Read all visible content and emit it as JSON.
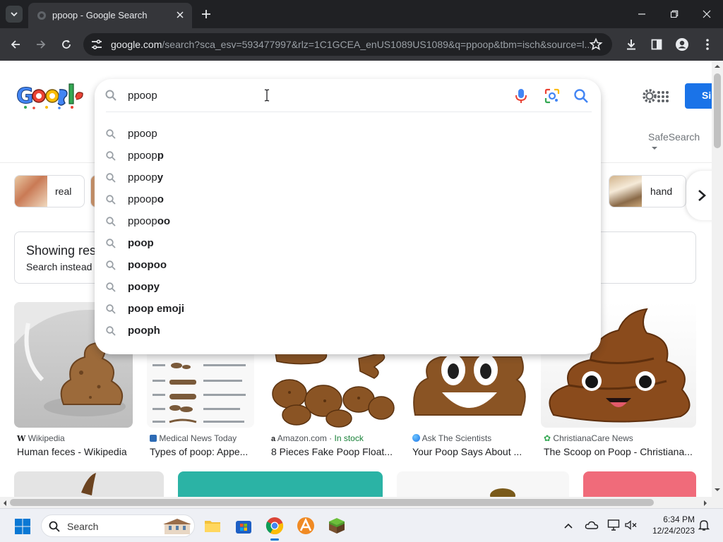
{
  "browser": {
    "tab_title": "ppoop - Google Search",
    "url_domain": "google.com",
    "url_path": "/search?sca_esv=593477997&rlz=1C1GCEA_enUS1089US1089&q=ppoop&tbm=isch&source=l..."
  },
  "search": {
    "query": "ppoop",
    "suggestions": [
      {
        "plain": "ppoop",
        "bold": ""
      },
      {
        "plain": "ppoop",
        "bold": "p"
      },
      {
        "plain": "ppoop",
        "bold": "y"
      },
      {
        "plain": "ppoop",
        "bold": "o"
      },
      {
        "plain": "ppoop",
        "bold": "oo"
      },
      {
        "plain": "",
        "bold": "poop"
      },
      {
        "plain": "",
        "bold": "poopoo"
      },
      {
        "plain": "",
        "bold": "poopy"
      },
      {
        "plain": "",
        "bold": "poop emoji"
      },
      {
        "plain": "",
        "bold": "pooph"
      }
    ]
  },
  "header": {
    "signin_label": "Si",
    "safesearch_label": "SafeSearch"
  },
  "chips": {
    "left_label": "real",
    "right_label": "hand"
  },
  "notice": {
    "line1": "Showing res",
    "line2": "Search instead"
  },
  "results": [
    {
      "source": "Wikipedia",
      "title": "Human feces - Wikipedia",
      "stock": ""
    },
    {
      "source": "Medical News Today",
      "title": "Types of poop: Appe...",
      "stock": ""
    },
    {
      "source": "Amazon.com",
      "title": "8 Pieces Fake Poop Float...",
      "stock": "In stock"
    },
    {
      "source": "Ask The Scientists",
      "title": "Your Poop Says About ...",
      "stock": ""
    },
    {
      "source": "ChristianaCare News",
      "title": "The Scoop on Poop - Christiana...",
      "stock": ""
    }
  ],
  "taskbar": {
    "search_label": "Search",
    "time": "6:34 PM",
    "date": "12/24/2023"
  },
  "colors": {
    "accent_blue": "#1a73e8",
    "stock_green": "#188038",
    "poop_brown": "#8a5424",
    "teal_card": "#2bb3a5",
    "pink_card": "#f06b7a"
  }
}
